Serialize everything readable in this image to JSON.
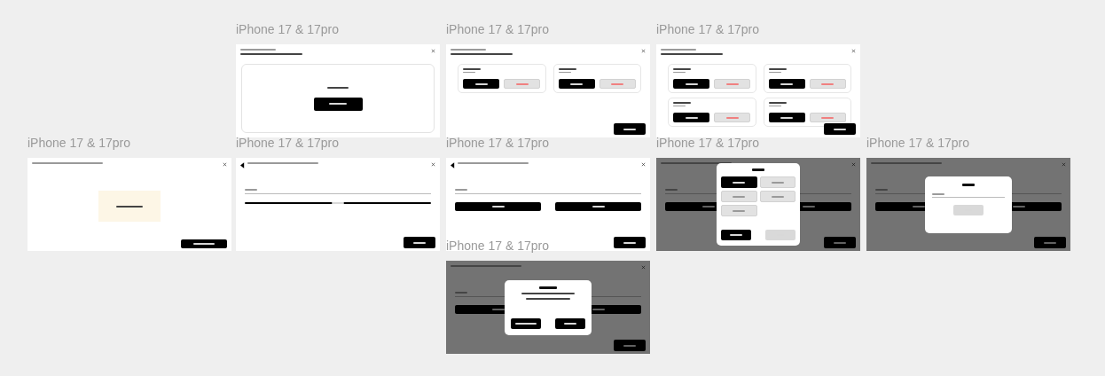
{
  "frames": [
    {
      "label": "iPhone 17 & 17pro",
      "kind": "empty-state"
    },
    {
      "label": "iPhone 17 & 17pro",
      "kind": "cards-2"
    },
    {
      "label": "iPhone 17 & 17pro",
      "kind": "cards-4"
    },
    {
      "label": "iPhone 17 & 17pro",
      "kind": "notice"
    },
    {
      "label": "iPhone 17 & 17pro",
      "kind": "input-single"
    },
    {
      "label": "iPhone 17 & 17pro",
      "kind": "input-double"
    },
    {
      "label": "iPhone 17 & 17pro",
      "kind": "modal-options",
      "options": [
        {
          "selected": true
        },
        {
          "selected": false
        },
        {
          "selected": false
        },
        {
          "selected": false
        },
        {
          "selected": false
        }
      ],
      "confirm_disabled": true
    },
    {
      "label": "iPhone 17 & 17pro",
      "kind": "modal-input",
      "submit_disabled": true
    },
    {
      "label": "iPhone 17 & 17pro",
      "kind": "modal-confirm"
    }
  ]
}
